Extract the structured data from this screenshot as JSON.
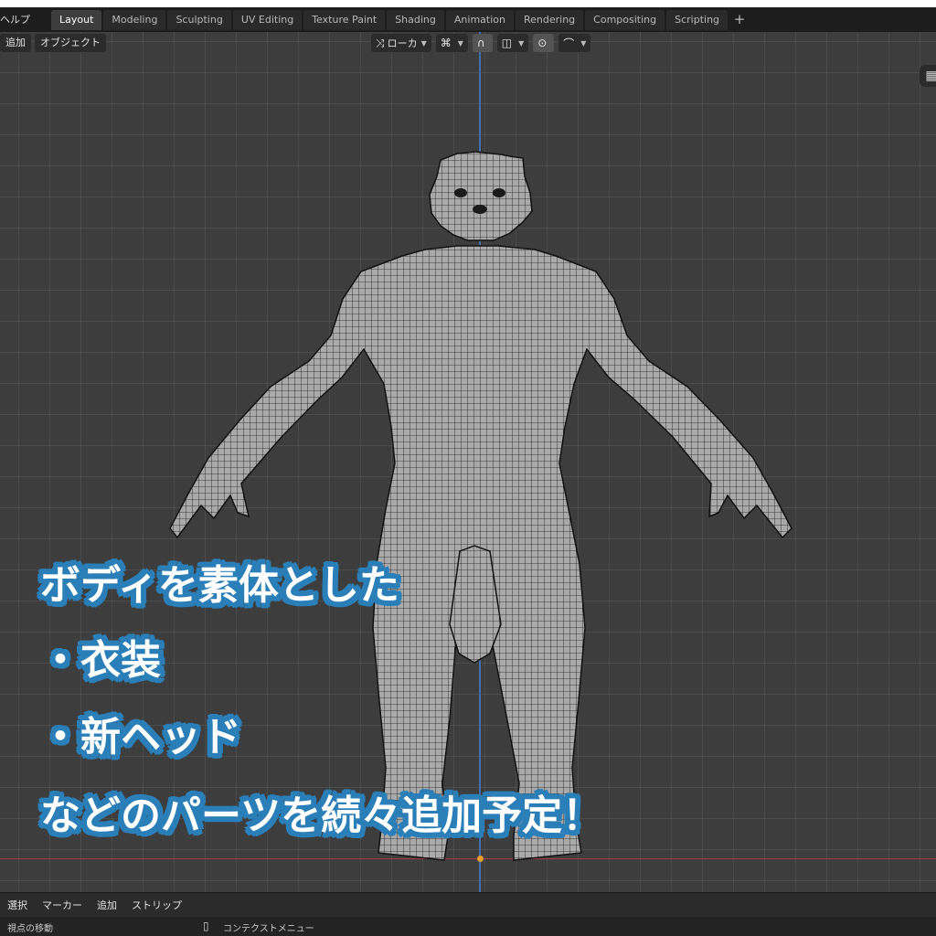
{
  "menu": {
    "help": "ヘルプ"
  },
  "tabs": [
    {
      "label": "Layout",
      "active": true
    },
    {
      "label": "Modeling"
    },
    {
      "label": "Sculpting"
    },
    {
      "label": "UV Editing"
    },
    {
      "label": "Texture Paint"
    },
    {
      "label": "Shading"
    },
    {
      "label": "Animation"
    },
    {
      "label": "Rendering"
    },
    {
      "label": "Compositing"
    },
    {
      "label": "Scripting"
    }
  ],
  "tab_add": "+",
  "viewport_header": {
    "add": "追加",
    "object": "オブジェクト",
    "orientation": "ローカ"
  },
  "overlay_text": {
    "line1": "ボディを素体とした",
    "line2": "・衣装",
    "line3": "・新ヘッド",
    "line4": "などのパーツを続々追加予定！"
  },
  "timeline": {
    "select": "選択",
    "marker": "マーカー",
    "add": "追加",
    "strip": "ストリップ"
  },
  "status": {
    "left": "視点の移動",
    "center": "コンテクストメニュー"
  },
  "colors": {
    "overlay_outline": "#2a7fb8",
    "axis_x": "#a23a43",
    "axis_y": "#3f6fb0",
    "origin": "#f19e2d"
  }
}
